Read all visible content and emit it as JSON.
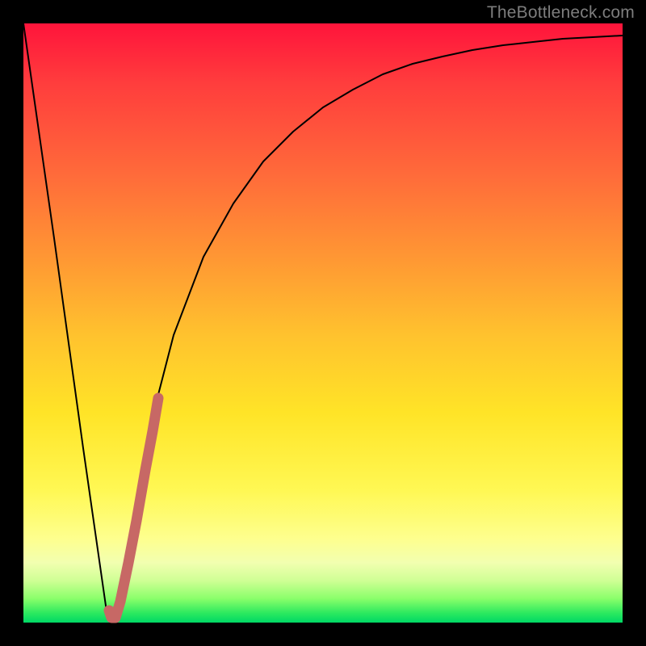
{
  "watermark": "TheBottleneck.com",
  "colors": {
    "frame": "#000000",
    "curve": "#000000",
    "highlight": "#c76865",
    "gradient_top": "#ff143b",
    "gradient_bottom": "#00d865"
  },
  "chart_data": {
    "type": "line",
    "title": "",
    "xlabel": "",
    "ylabel": "",
    "xlim": [
      0,
      100
    ],
    "ylim": [
      0,
      100
    ],
    "grid": false,
    "series": [
      {
        "name": "bottleneck-curve",
        "x": [
          0,
          5,
          10,
          14,
          15,
          16,
          18,
          20,
          22,
          25,
          30,
          35,
          40,
          45,
          50,
          55,
          60,
          65,
          70,
          75,
          80,
          85,
          90,
          95,
          100
        ],
        "y": [
          100,
          64,
          29,
          1,
          0,
          4,
          15,
          26,
          36,
          48,
          61,
          70,
          77,
          82,
          86,
          89,
          91.5,
          93.2,
          94.5,
          95.5,
          96.3,
          96.9,
          97.4,
          97.7,
          98
        ]
      },
      {
        "name": "highlight-segment",
        "x": [
          14.3,
          14.7,
          15.3,
          16.2,
          17.5,
          18.8,
          20.3,
          21.5,
          22.5
        ],
        "y": [
          2.0,
          0.8,
          0.8,
          3.5,
          10.0,
          17.0,
          25.5,
          32.0,
          37.5
        ]
      }
    ],
    "notes": "V-shaped bottleneck curve. Left branch is a steep near-linear drop from 100% to a minimum near x≈15. Right branch rises quickly then asymptotically flattens toward ~98%. The highlighted pink/rose segment marks the region around the minimum on the valley and the start of the rising branch."
  }
}
